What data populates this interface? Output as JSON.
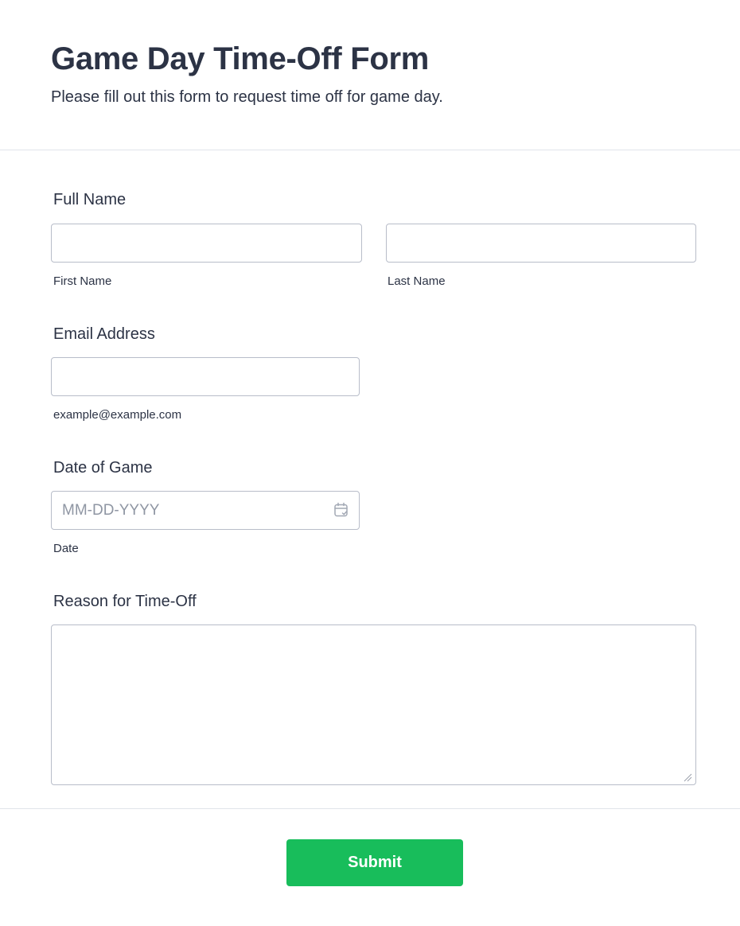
{
  "header": {
    "title": "Game Day Time-Off Form",
    "subtitle": "Please fill out this form to request time off for game day."
  },
  "full_name": {
    "label": "Full Name",
    "first": {
      "value": "",
      "sublabel": "First Name"
    },
    "last": {
      "value": "",
      "sublabel": "Last Name"
    }
  },
  "email": {
    "label": "Email Address",
    "value": "",
    "sublabel": "example@example.com"
  },
  "date": {
    "label": "Date of Game",
    "value": "",
    "placeholder": "MM-DD-YYYY",
    "sublabel": "Date",
    "icon": "calendar-icon"
  },
  "reason": {
    "label": "Reason for Time-Off",
    "value": ""
  },
  "submit": {
    "label": "Submit",
    "color": "#18bd5b"
  }
}
